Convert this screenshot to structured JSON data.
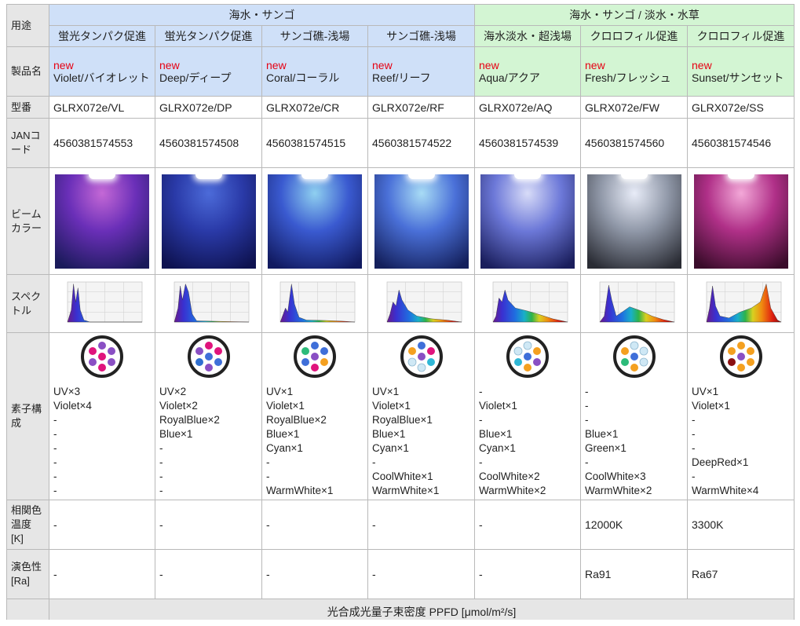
{
  "labels": {
    "use": "用途",
    "product": "製品名",
    "model": "型番",
    "jan": "JANコード",
    "beam": "ビームカラー",
    "spectrum": "スペクトル",
    "elements": "素子構成",
    "cct": "相関色温度 [K]",
    "cri": "演色性 [Ra]"
  },
  "groups": [
    {
      "label": "海水・サンゴ"
    },
    {
      "label": "海水・サンゴ / 淡水・水草"
    }
  ],
  "ppfd_title": "光合成光量子束密度 PPFD [μmol/m²/s]",
  "new_label": "new",
  "products": [
    {
      "use": "蛍光タンパク促進",
      "name": "Violet/バイオレット",
      "model": "GLRX072e/VL",
      "jan": "4560381574553",
      "beam": {
        "center": "#c468d6",
        "mid": "#6a2fb8",
        "edge": "#1a1a5a"
      },
      "spectrum": "violet",
      "leds": [
        "#8a4fc4",
        "#e0147d",
        "#8a4fc4",
        "#e0147d",
        "#8a4fc4",
        "#8a4fc4",
        "#e0147d"
      ],
      "elements": [
        "UV×3",
        "Violet×4",
        "-",
        "-",
        "-",
        "-",
        "-",
        "-"
      ],
      "cct": "-",
      "cri": "-"
    },
    {
      "use": "蛍光タンパク促進",
      "name": "Deep/ディープ",
      "model": "GLRX072e/DP",
      "jan": "4560381574508",
      "beam": {
        "center": "#4c6bd9",
        "mid": "#2a3aa8",
        "edge": "#0e1250"
      },
      "spectrum": "deep",
      "leds": [
        "#e0147d",
        "#8a4fc4",
        "#e0147d",
        "#3f6fd9",
        "#2f6fd0",
        "#3f6fd9",
        "#8a4fc4"
      ],
      "elements": [
        "UV×2",
        "Violet×2",
        "RoyalBlue×2",
        "Blue×1",
        "-",
        "-",
        "-",
        "-"
      ],
      "cct": "-",
      "cri": "-"
    },
    {
      "use": "サンゴ礁-浅場",
      "name": "Coral/コーラル",
      "model": "GLRX072e/CR",
      "jan": "4560381574515",
      "beam": {
        "center": "#8fd0f0",
        "mid": "#3a5ad0",
        "edge": "#111a60"
      },
      "spectrum": "coral",
      "leds": [
        "#3f6fd9",
        "#2dbb7a",
        "#3f6fd9",
        "#8a4fc4",
        "#3f6fd9",
        "#f4a020",
        "#e0147d"
      ],
      "elements": [
        "UV×1",
        "Violet×1",
        "RoyalBlue×2",
        "Blue×1",
        "Cyan×1",
        "-",
        "-",
        "WarmWhite×1"
      ],
      "cct": "-",
      "cri": "-"
    },
    {
      "use": "サンゴ礁-浅場",
      "name": "Reef/リーフ",
      "model": "GLRX072e/RF",
      "jan": "4560381574522",
      "beam": {
        "center": "#a8dcf5",
        "mid": "#4a70d8",
        "edge": "#14205c"
      },
      "spectrum": "reef",
      "leds": [
        "#3f6fd9",
        "#f4a020",
        "#e0147d",
        "#8a4fc4",
        "#cfe8f5",
        "#2fb7d6",
        "#cfe8f5"
      ],
      "elements": [
        "UV×1",
        "Violet×1",
        "RoyalBlue×1",
        "Blue×1",
        "Cyan×1",
        "-",
        "CoolWhite×1",
        "WarmWhite×1"
      ],
      "cct": "-",
      "cri": "-"
    },
    {
      "use": "海水淡水・超浅場",
      "name": "Aqua/アクア",
      "model": "GLRX072e/AQ",
      "jan": "4560381574539",
      "beam": {
        "center": "#d8dcf8",
        "mid": "#6c78d8",
        "edge": "#1a1e5c"
      },
      "spectrum": "aqua",
      "leds": [
        "#cfe8f5",
        "#cfe8f5",
        "#f4a020",
        "#3f6fd9",
        "#2fb7d6",
        "#8a4fc4",
        "#f4a020"
      ],
      "elements": [
        "-",
        "Violet×1",
        "-",
        "Blue×1",
        "Cyan×1",
        "-",
        "CoolWhite×2",
        "WarmWhite×2"
      ],
      "cct": "-",
      "cri": "-"
    },
    {
      "use": "クロロフィル促進",
      "name": "Fresh/フレッシュ",
      "model": "GLRX072e/FW",
      "jan": "4560381574560",
      "beam": {
        "center": "#e8ecf8",
        "mid": "#9098a8",
        "edge": "#2a2c34"
      },
      "spectrum": "fresh",
      "leds": [
        "#cfe8f5",
        "#f4a020",
        "#cfe8f5",
        "#3f6fd9",
        "#2dbb7a",
        "#cfe8f5",
        "#f4a020"
      ],
      "elements": [
        "-",
        "-",
        "-",
        "Blue×1",
        "Green×1",
        "-",
        "CoolWhite×3",
        "WarmWhite×2"
      ],
      "cct": "12000K",
      "cri": "Ra91"
    },
    {
      "use": "クロロフィル促進",
      "name": "Sunset/サンセット",
      "model": "GLRX072e/SS",
      "jan": "4560381574546",
      "beam": {
        "center": "#f3a8d8",
        "mid": "#b03088",
        "edge": "#3a0c2a"
      },
      "spectrum": "sunset",
      "leds": [
        "#f4a020",
        "#f4a020",
        "#f4a020",
        "#8a4fc4",
        "#8b1010",
        "#f4a020",
        "#f4a020"
      ],
      "elements": [
        "UV×1",
        "Violet×1",
        "-",
        "-",
        "-",
        "DeepRed×1",
        "-",
        "WarmWhite×4"
      ],
      "cct": "3300K",
      "cri": "Ra67"
    }
  ]
}
